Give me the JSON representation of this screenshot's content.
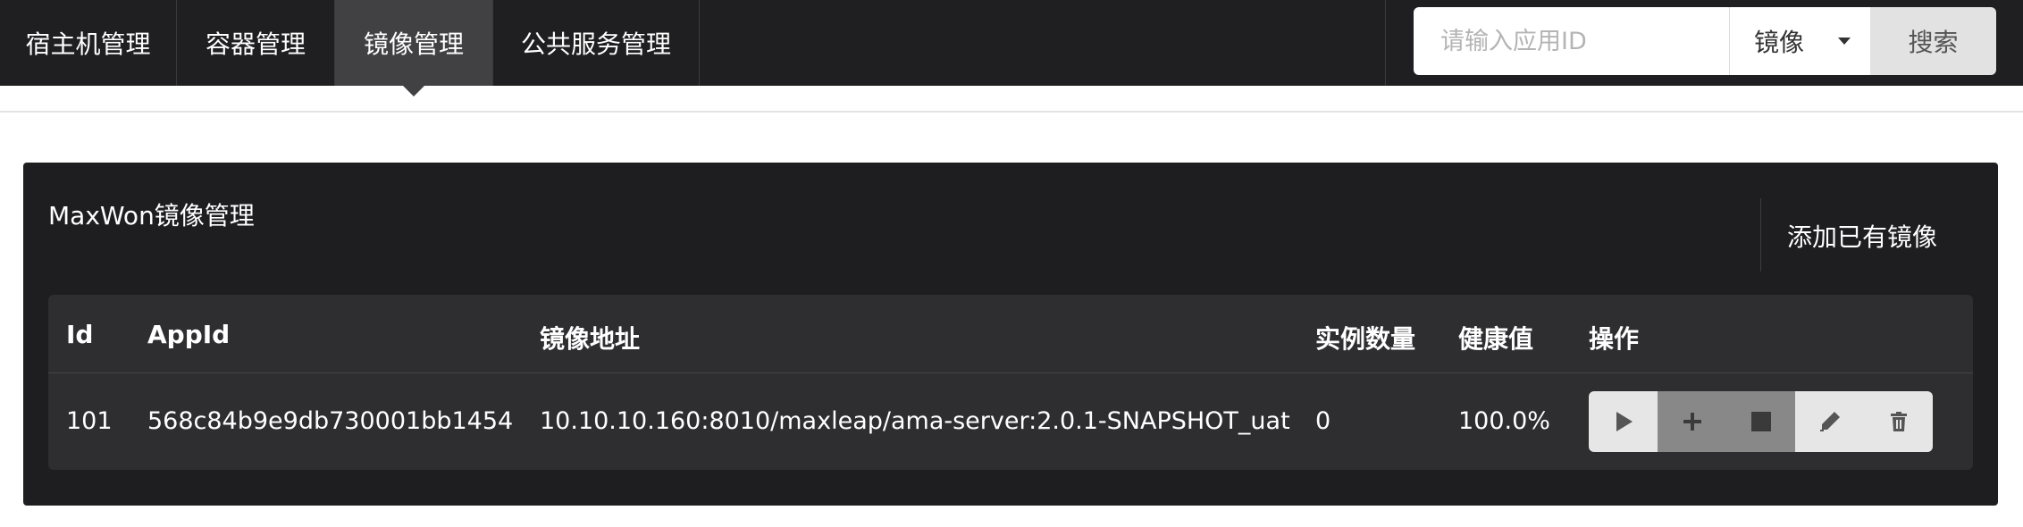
{
  "nav": {
    "items": [
      {
        "label": "宿主机管理",
        "active": false
      },
      {
        "label": "容器管理",
        "active": false
      },
      {
        "label": "镜像管理",
        "active": true
      },
      {
        "label": "公共服务管理",
        "active": false
      }
    ]
  },
  "search": {
    "placeholder": "请输入应用ID",
    "value": "",
    "type_selected": "镜像",
    "button_label": "搜索"
  },
  "panel": {
    "title": "MaxWon镜像管理",
    "add_label": "添加已有镜像"
  },
  "table": {
    "headers": [
      "Id",
      "AppId",
      "镜像地址",
      "实例数量",
      "健康值",
      "操作"
    ],
    "rows": [
      [
        "101",
        "568c84b9e9db730001bb1454",
        "10.10.10.160:8010/maxleap/ama-server:2.0.1-SNAPSHOT_uat",
        "0",
        "100.0%"
      ]
    ]
  },
  "actions": [
    {
      "icon": "play-icon",
      "state": "enabled"
    },
    {
      "icon": "plus-icon",
      "state": "disabled"
    },
    {
      "icon": "stop-icon",
      "state": "disabled"
    },
    {
      "icon": "pencil-icon",
      "state": "enabled"
    },
    {
      "icon": "trash-icon",
      "state": "enabled"
    }
  ],
  "colors": {
    "topbar": "#1f1f21",
    "nav_active": "#414143",
    "panel": "#1e1e20",
    "table": "#2e2e30",
    "action_enabled": "#e6e6e6",
    "action_disabled": "#888888"
  }
}
